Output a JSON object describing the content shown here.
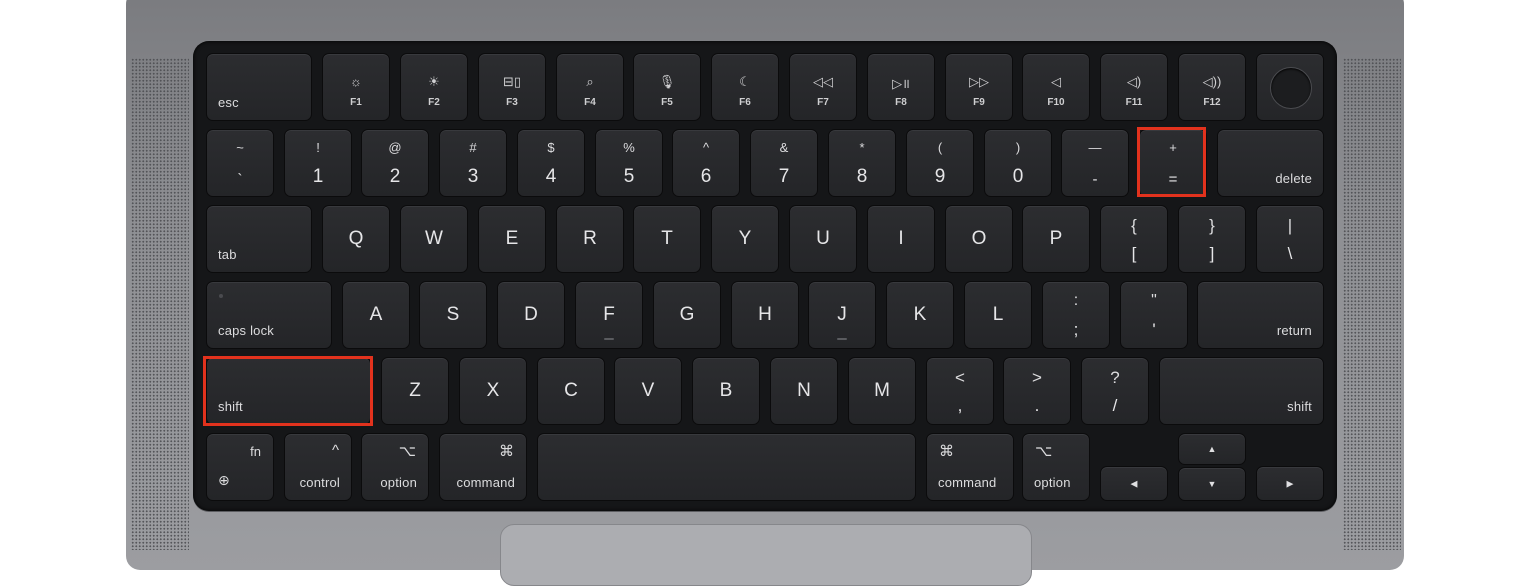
{
  "colors": {
    "highlight": "#e2321d",
    "key": "#2a2b2e",
    "chassis": "#8e8f93"
  },
  "highlighted_keys": [
    "equals",
    "left-shift"
  ],
  "row_function": {
    "esc": "esc",
    "keys": [
      {
        "label": "F1",
        "icon": "brightness-down-icon",
        "glyph": "☼"
      },
      {
        "label": "F2",
        "icon": "brightness-up-icon",
        "glyph": "☀"
      },
      {
        "label": "F3",
        "icon": "mission-control-icon",
        "glyph": "⊟▯"
      },
      {
        "label": "F4",
        "icon": "search-icon",
        "glyph": "⌕"
      },
      {
        "label": "F5",
        "icon": "microphone-icon",
        "glyph": "🎙"
      },
      {
        "label": "F6",
        "icon": "do-not-disturb-moon-icon",
        "glyph": "☾"
      },
      {
        "label": "F7",
        "icon": "rewind-icon",
        "glyph": "◁◁"
      },
      {
        "label": "F8",
        "icon": "play-pause-icon",
        "glyph": "▷॥"
      },
      {
        "label": "F9",
        "icon": "fast-forward-icon",
        "glyph": "▷▷"
      },
      {
        "label": "F10",
        "icon": "mute-icon",
        "glyph": "◁"
      },
      {
        "label": "F11",
        "icon": "volume-down-icon",
        "glyph": "◁)"
      },
      {
        "label": "F12",
        "icon": "volume-up-icon",
        "glyph": "◁))"
      }
    ]
  },
  "row_number": {
    "keys": [
      {
        "top": "~",
        "bot": "`"
      },
      {
        "top": "!",
        "bot": "1"
      },
      {
        "top": "@",
        "bot": "2"
      },
      {
        "top": "#",
        "bot": "3"
      },
      {
        "top": "$",
        "bot": "4"
      },
      {
        "top": "%",
        "bot": "5"
      },
      {
        "top": "^",
        "bot": "6"
      },
      {
        "top": "&",
        "bot": "7"
      },
      {
        "top": "*",
        "bot": "8"
      },
      {
        "top": "(",
        "bot": "9"
      },
      {
        "top": ")",
        "bot": "0"
      },
      {
        "top": "—",
        "bot": "-"
      },
      {
        "top": "+",
        "bot": "="
      }
    ],
    "delete": "delete"
  },
  "row_qwerty": {
    "tab": "tab",
    "letters": [
      "Q",
      "W",
      "E",
      "R",
      "T",
      "Y",
      "U",
      "I",
      "O",
      "P"
    ],
    "brackets": [
      {
        "top": "{",
        "bot": "["
      },
      {
        "top": "}",
        "bot": "]"
      },
      {
        "top": "|",
        "bot": "\\"
      }
    ]
  },
  "row_home": {
    "caps": "caps lock",
    "letters": [
      "A",
      "S",
      "D",
      "F",
      "G",
      "H",
      "J",
      "K",
      "L"
    ],
    "punct": [
      {
        "top": ":",
        "bot": ";"
      },
      {
        "top": "\"",
        "bot": "'"
      }
    ],
    "return": "return"
  },
  "row_shift": {
    "left_shift": "shift",
    "letters": [
      "Z",
      "X",
      "C",
      "V",
      "B",
      "N",
      "M"
    ],
    "punct": [
      {
        "top": "<",
        "bot": ","
      },
      {
        "top": ">",
        "bot": "."
      },
      {
        "top": "?",
        "bot": "/"
      }
    ],
    "right_shift": "shift"
  },
  "row_bottom": {
    "fn": "fn",
    "globe_glyph": "⊕",
    "control": "control",
    "control_glyph": "^",
    "option": "option",
    "option_glyph": "⌥",
    "command": "command",
    "command_glyph": "⌘",
    "arrows": {
      "up": "▲",
      "down": "▼",
      "left": "◀",
      "right": "▶"
    }
  }
}
